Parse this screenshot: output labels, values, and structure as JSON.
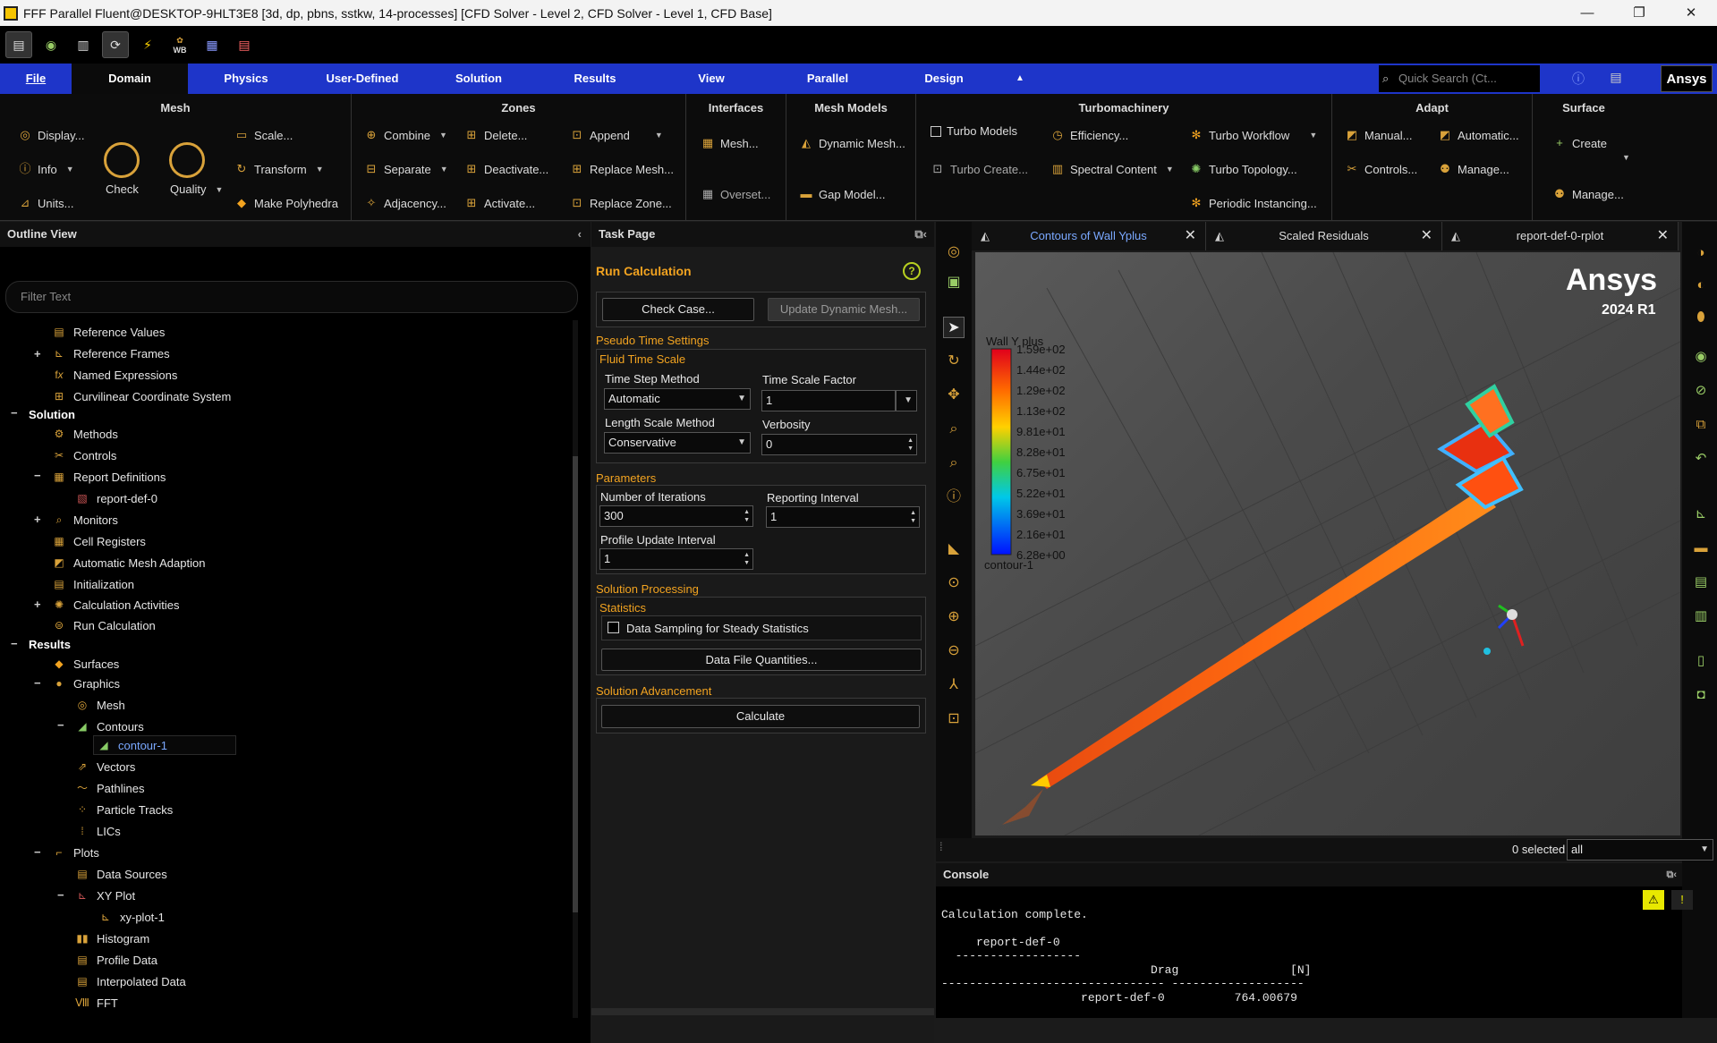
{
  "titlebar": {
    "title": "FFF Parallel Fluent@DESKTOP-9HLT3E8  [3d, dp, pbns, sstkw, 14-processes] [CFD Solver - Level 2, CFD Solver - Level 1, CFD Base]",
    "min": "—",
    "max": "❐",
    "close": "✕"
  },
  "quick_toolbar": {
    "wb_label": "WB"
  },
  "menu": {
    "file": "File",
    "tabs": [
      "Domain",
      "Physics",
      "User-Defined",
      "Solution",
      "Results",
      "View",
      "Parallel",
      "Design"
    ],
    "search_placeholder": "Quick Search (Ct...",
    "logo": "Ansys"
  },
  "ribbon": {
    "mesh": {
      "title": "Mesh",
      "display": "Display...",
      "info": "Info",
      "units": "Units...",
      "check": "Check",
      "quality": "Quality",
      "scale": "Scale...",
      "transform": "Transform",
      "make_polyhedra": "Make Polyhedra"
    },
    "zones": {
      "title": "Zones",
      "combine": "Combine",
      "separate": "Separate",
      "adjacency": "Adjacency...",
      "delete": "Delete...",
      "deactivate": "Deactivate...",
      "activate": "Activate...",
      "append": "Append",
      "replace_mesh": "Replace Mesh...",
      "replace_zone": "Replace Zone..."
    },
    "interfaces": {
      "title": "Interfaces",
      "mesh": "Mesh...",
      "overset": "Overset..."
    },
    "mesh_models": {
      "title": "Mesh Models",
      "dynamic_mesh": "Dynamic Mesh...",
      "gap_model": "Gap Model..."
    },
    "turbomachinery": {
      "title": "Turbomachinery",
      "turbo_models": "Turbo Models",
      "turbo_create": "Turbo Create...",
      "efficiency": "Efficiency...",
      "spectral_content": "Spectral Content",
      "turbo_workflow": "Turbo Workflow",
      "turbo_topology": "Turbo Topology...",
      "periodic_instancing": "Periodic Instancing..."
    },
    "adapt": {
      "title": "Adapt",
      "manual": "Manual...",
      "automatic": "Automatic...",
      "controls": "Controls...",
      "manage": "Manage..."
    },
    "surface": {
      "title": "Surface",
      "create": "Create",
      "manage": "Manage..."
    }
  },
  "outline": {
    "title": "Outline View",
    "filter_placeholder": "Filter Text",
    "items": {
      "reference_values": "Reference Values",
      "reference_frames": "Reference Frames",
      "named_expressions": "Named Expressions",
      "curvilinear": "Curvilinear Coordinate System",
      "solution": "Solution",
      "methods": "Methods",
      "controls": "Controls",
      "report_definitions": "Report Definitions",
      "report_def_0": "report-def-0",
      "monitors": "Monitors",
      "cell_registers": "Cell Registers",
      "auto_mesh_adaption": "Automatic Mesh Adaption",
      "initialization": "Initialization",
      "calculation_activities": "Calculation Activities",
      "run_calculation": "Run Calculation",
      "results": "Results",
      "surfaces": "Surfaces",
      "graphics": "Graphics",
      "mesh": "Mesh",
      "contours": "Contours",
      "contour_1": "contour-1",
      "vectors": "Vectors",
      "pathlines": "Pathlines",
      "particle_tracks": "Particle Tracks",
      "lics": "LICs",
      "plots": "Plots",
      "data_sources": "Data Sources",
      "xy_plot": "XY Plot",
      "xy_plot_1": "xy-plot-1",
      "histogram": "Histogram",
      "profile_data": "Profile Data",
      "interpolated_data": "Interpolated Data",
      "fft": "FFT"
    }
  },
  "task": {
    "title": "Task Page",
    "heading": "Run Calculation",
    "check_case": "Check Case...",
    "update_dynamic_mesh": "Update Dynamic Mesh...",
    "pseudo_time_settings": "Pseudo Time Settings",
    "fluid_time_scale": "Fluid Time Scale",
    "time_step_method_label": "Time Step Method",
    "time_step_method": "Automatic",
    "time_scale_factor_label": "Time Scale Factor",
    "time_scale_factor": "1",
    "length_scale_method_label": "Length Scale Method",
    "length_scale_method": "Conservative",
    "verbosity_label": "Verbosity",
    "verbosity": "0",
    "parameters": "Parameters",
    "iterations_label": "Number of Iterations",
    "iterations": "300",
    "reporting_interval_label": "Reporting Interval",
    "reporting_interval": "1",
    "profile_update_label": "Profile Update Interval",
    "profile_update": "1",
    "solution_processing": "Solution Processing",
    "statistics": "Statistics",
    "data_sampling": "Data Sampling for Steady Statistics",
    "data_file_quantities": "Data File Quantities...",
    "solution_advancement": "Solution Advancement",
    "calculate": "Calculate"
  },
  "graphics": {
    "tabs": [
      "Contours of Wall Yplus",
      "Scaled Residuals",
      "report-def-0-rplot"
    ],
    "brand": "Ansys",
    "version": "2024 R1",
    "legend_title": "Wall Y plus",
    "contour_name": "contour-1",
    "legend_values": [
      "1.59e+02",
      "1.44e+02",
      "1.29e+02",
      "1.13e+02",
      "9.81e+01",
      "8.28e+01",
      "6.75e+01",
      "5.22e+01",
      "3.69e+01",
      "2.16e+01",
      "6.28e+00"
    ],
    "selected": "0 selected",
    "select_filter": "all"
  },
  "console": {
    "title": "Console",
    "lines": [
      "Calculation complete.",
      "",
      "     report-def-0",
      "  ------------------",
      "                              Drag                [N]",
      "-------------------------------- -------------------",
      "                    report-def-0          764.00679"
    ]
  }
}
